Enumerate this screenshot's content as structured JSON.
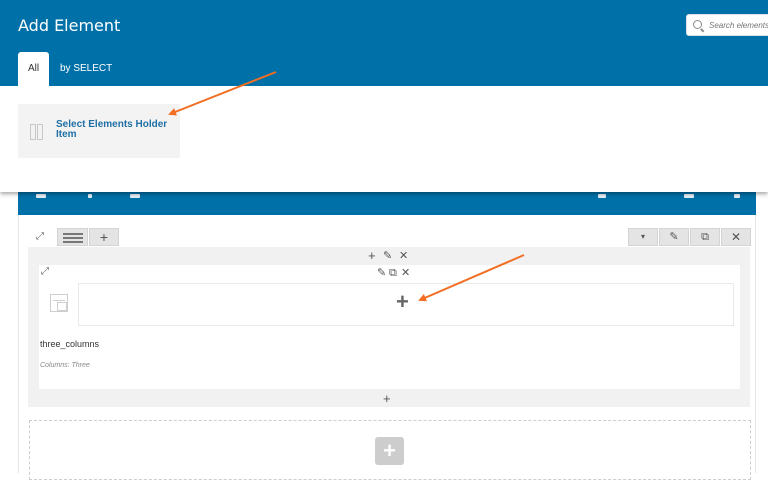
{
  "modal": {
    "title": "Add Element",
    "search_placeholder": "Search elements",
    "tabs": [
      {
        "label": "All",
        "active": true
      },
      {
        "label": "by SELECT",
        "active": false
      }
    ],
    "element_card": {
      "label": "Select Elements Holder Item",
      "icon": "holder-icon"
    }
  },
  "builder": {
    "column": {
      "name": "three_columns",
      "description": "Columns: Three"
    },
    "add_symbol": "+"
  },
  "colors": {
    "header_blue": "#0071a8",
    "link_blue": "#1f6fa5",
    "arrow_orange": "#f26e22"
  }
}
